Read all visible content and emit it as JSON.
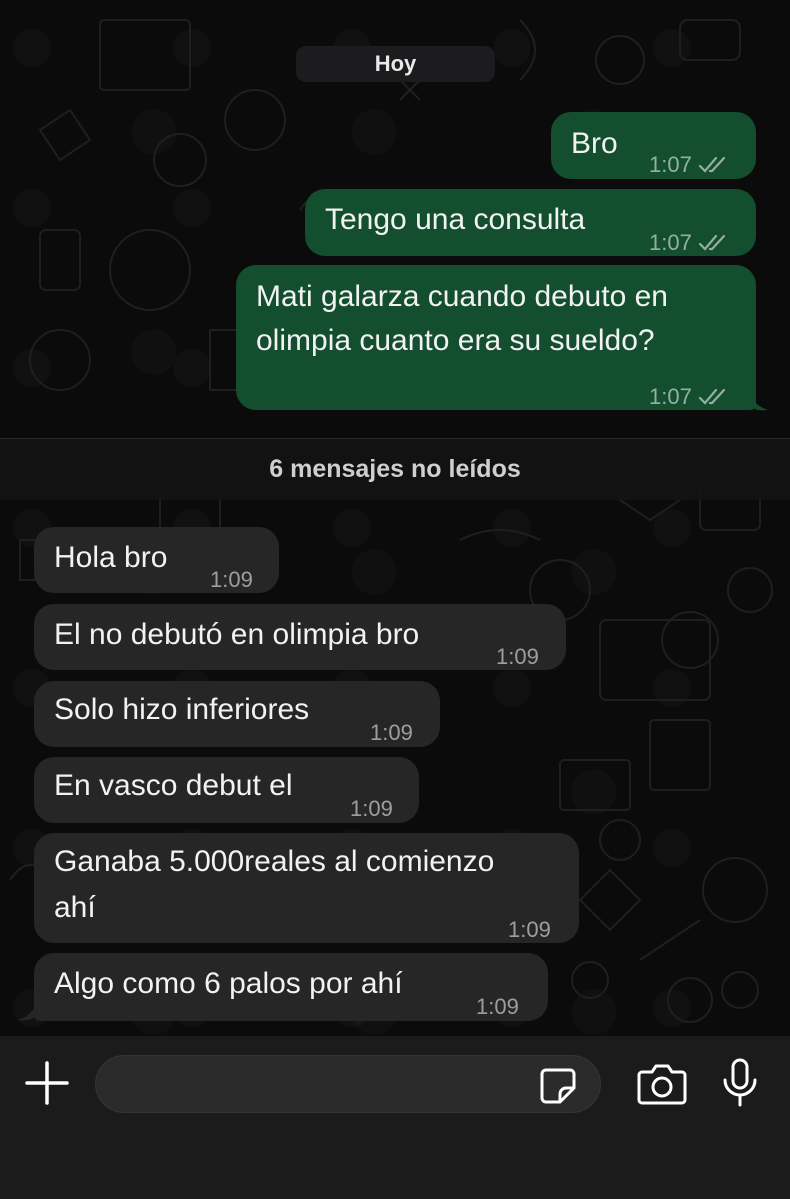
{
  "chat": {
    "date_label": "Hoy",
    "unread_label": "6 mensajes no leídos",
    "outgoing": [
      {
        "text": "Bro",
        "time": "1:07"
      },
      {
        "text": "Tengo una consulta",
        "time": "1:07"
      },
      {
        "text_line1": "Mati galarza cuando debuto en",
        "text_line2": "olimpia cuanto era su sueldo?",
        "time": "1:07"
      }
    ],
    "incoming": [
      {
        "text": "Hola bro",
        "time": "1:09"
      },
      {
        "text": "El no debutó en olimpia bro",
        "time": "1:09"
      },
      {
        "text": "Solo hizo inferiores",
        "time": "1:09"
      },
      {
        "text": "En vasco debut el",
        "time": "1:09"
      },
      {
        "text_line1": "Ganaba 5.000reales al comienzo",
        "text_line2": "ahí",
        "time": "1:09"
      },
      {
        "text": "Algo como 6 palos por ahí",
        "time": "1:09"
      }
    ]
  },
  "input_bar": {
    "placeholder": "",
    "icons": [
      "plus-icon",
      "sticker-icon",
      "camera-icon",
      "microphone-icon"
    ]
  },
  "colors": {
    "outgoing_bubble": "#134e2e",
    "incoming_bubble": "#262626",
    "background": "#0b0b0b"
  }
}
